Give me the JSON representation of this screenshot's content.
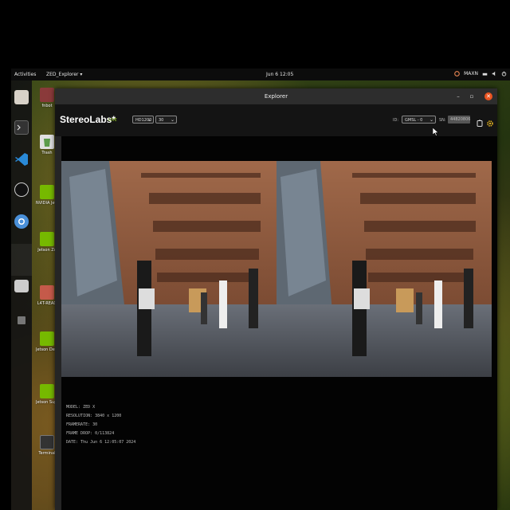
{
  "topbar": {
    "activities": "Activities",
    "app_menu": "ZED_Explorer ▾",
    "clock": "Jun 6  12:05",
    "tray_text": "MAXN"
  },
  "desktop": {
    "icons": [
      {
        "label": "fnbot"
      },
      {
        "label": "Trash"
      },
      {
        "label": "NVIDIA Jets Community"
      },
      {
        "label": "Jetson Zo"
      },
      {
        "label": "L4T-READ"
      },
      {
        "label": "Jetson Developer Z"
      },
      {
        "label": "Jetson Supp Forums"
      },
      {
        "label": "Terminal"
      }
    ]
  },
  "window": {
    "title": "Explorer",
    "brand": "StereoLabs*",
    "live": "LIVE",
    "resolution_value": "HD1200",
    "fps_value": "30",
    "id_label": "ID:",
    "id_value": "GMSL - 0",
    "sn_label": "SN:",
    "sn_value": "44820806"
  },
  "overlay": {
    "model": "MODEL: ZED X",
    "resolution": "RESOLUTION: 3840 x 1200",
    "framerate": "FRAMERATE: 30",
    "frame_drop": "FRAME DROP: 0/113824",
    "date": "DATE: Thu Jun 6 12:05:07 2024"
  },
  "colors": {
    "accent_orange": "#e95420",
    "live_green": "#9bd12a",
    "window_bg": "#141414"
  }
}
